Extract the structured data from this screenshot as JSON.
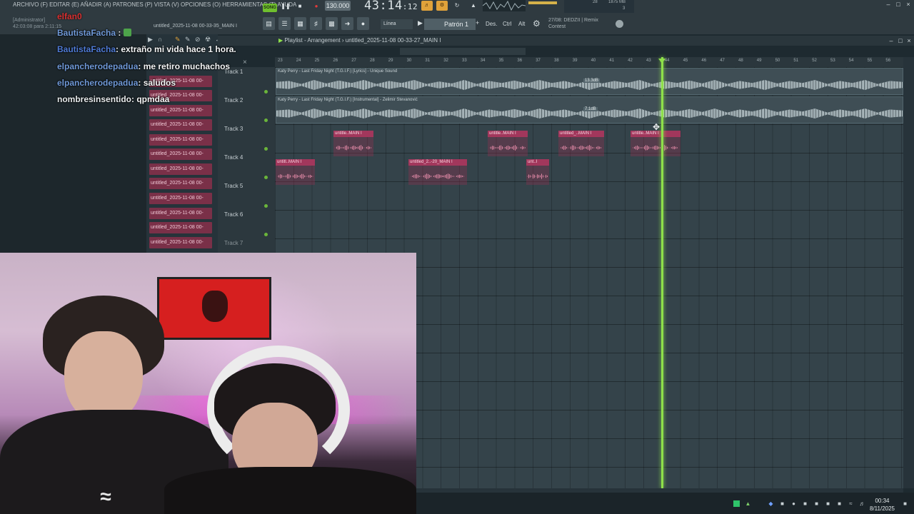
{
  "menu": {
    "text": "ARCHIVO (F) EDITAR (E) AÑADIR (A) PATRONES (P) VISTA (V) OPCIONES (O) HERRAMIENTAS (T) AYUDA",
    "admin_label": "[Administrator]",
    "admin_time": "42:03:08 para 2:11:15",
    "tab_title": "untitled_2025-11-08 00-33-35_MAIN I"
  },
  "transport": {
    "song_label": "SONG",
    "tempo": "130.000",
    "time_main": "43:14",
    "time_sub": ":12",
    "snap": "Línea",
    "pattern": "Patrón 1",
    "keys": [
      "Des.",
      "Ctrl",
      "Alt"
    ],
    "cpu_ram": "1875 MB",
    "cpu_a": "28",
    "cpu_b": "3",
    "hint_line1": "27/08: DEDZII | Remix",
    "hint_line2": "Contest"
  },
  "chat": {
    "top_user": "elfan0",
    "lines": [
      {
        "user": "BautistaFacha",
        "msg": ":"
      },
      {
        "user": "BautistaFacha",
        "msg": ": extraño mi vida hace 1 hora."
      },
      {
        "user": "elpancherodepadua",
        "msg": ": me retiro muchachos"
      },
      {
        "user": "elpancherodepadua",
        "msg": ": saludos"
      },
      {
        "user": "nombresinsentido",
        "msg": ": qpmdaa"
      }
    ]
  },
  "patterns": [
    "untitled_2025-11-08 00-",
    "untitled_2025-11-08 00-",
    "untitled_2025-11-08 00-",
    "untitled_2025-11-08 00-",
    "untitled_2025-11-08 00-",
    "untitled_2025-11-08 00-",
    "untitled_2025-11-08 00-",
    "untitled_2025-11-08 00-",
    "untitled_2025-11-08 00-",
    "untitled_2025-11-08 00-",
    "untitled_2025-11-08 00-",
    "untitled_2025-11-08 00-"
  ],
  "playlist": {
    "title": "Playlist - Arrangement",
    "file": "untitled_2025-11-08 00-33-27_MAIN I",
    "ruler": [
      "23",
      "24",
      "25",
      "26",
      "27",
      "28",
      "29",
      "30",
      "31",
      "32",
      "33",
      "34",
      "35",
      "36",
      "37",
      "38",
      "39",
      "40",
      "41",
      "42",
      "43",
      "44",
      "45",
      "46",
      "47",
      "48",
      "49",
      "50",
      "51",
      "52",
      "53",
      "54",
      "55",
      "56"
    ],
    "tracks": [
      "Track 1",
      "Track 2",
      "Track 3",
      "Track 4",
      "Track 5",
      "Track 6",
      "Track 7"
    ],
    "audio_clips": [
      {
        "label": "Katy Perry - Last Friday Night (T.G.I.F.) [Lyrics] - Unique Sound",
        "db": "13.3dB"
      },
      {
        "label": "Katy Perry - Last Friday Night (T.G.I.F.) [Instrumental] - Zelimir Stevanović",
        "db": "7.1dB"
      }
    ],
    "pattern_clips": [
      "untitle..MAIN I",
      "untitle..MAIN I",
      "untitled_..MAIN I",
      "untitle..MAIN I",
      "untitl..MAIN I",
      "untitled_2..-20_MAIN I",
      "unt..I"
    ]
  },
  "taskbar": {
    "time": "00:34",
    "date": "8/11/2025"
  },
  "colors": {
    "accent_green": "#8ee04a",
    "pattern_clip": "#a2375c",
    "record_red": "#e23b3b",
    "song_green": "#6fbf2e"
  }
}
